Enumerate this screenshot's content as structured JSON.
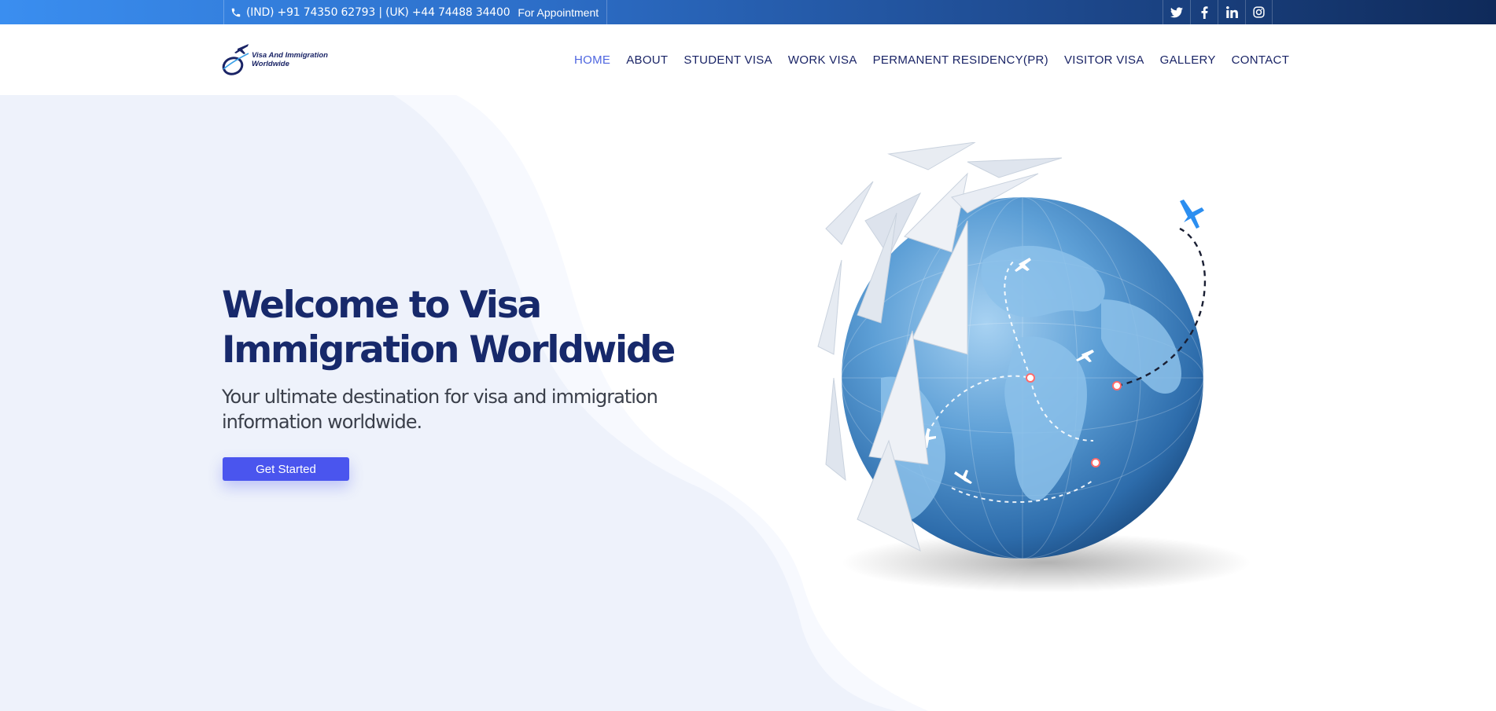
{
  "topbar": {
    "phones": "(IND) +91 74350 62793 | (UK) +44 74488 34400",
    "appointment": "For Appointment",
    "social": [
      "twitter-icon",
      "facebook-icon",
      "linkedin-icon",
      "instagram-icon"
    ]
  },
  "header": {
    "logo_line1": "Visa And Immigration",
    "logo_line2": "Worldwide",
    "nav": [
      {
        "label": "HOME",
        "active": true
      },
      {
        "label": "ABOUT"
      },
      {
        "label": "STUDENT VISA"
      },
      {
        "label": "WORK VISA"
      },
      {
        "label": "PERMANENT RESIDENCY(PR)"
      },
      {
        "label": "VISITOR VISA"
      },
      {
        "label": "GALLERY"
      },
      {
        "label": "CONTACT"
      }
    ]
  },
  "hero": {
    "title": "Welcome to Visa Immigration Worldwide",
    "subtitle": "Your ultimate destination for visa and immigration information worldwide.",
    "cta_label": "Get Started"
  },
  "colors": {
    "brand_dark": "#17296b",
    "accent": "#4a55ee",
    "nav_active": "#4e66e0"
  }
}
